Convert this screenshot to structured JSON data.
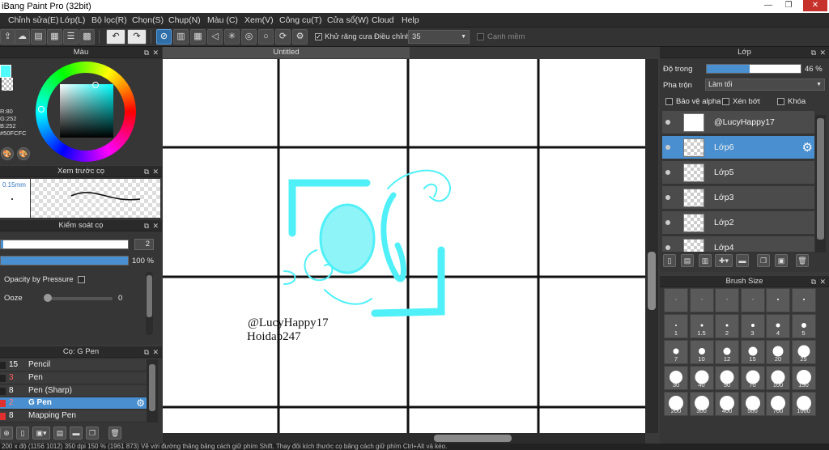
{
  "window": {
    "title": "iBang Paint Pro (32bit)"
  },
  "menu": [
    "Chỉnh sửa(E)",
    "Lớp(L)",
    "Bộ lọc(R)",
    "Chọn(S)",
    "Chụp(N)",
    "Màu (C)",
    "Xem(V)",
    "Công cụ(T)",
    "Cửa sổ(W)",
    "Cloud",
    "Help"
  ],
  "toolbar": {
    "antialias_label": "Khử răng cưa",
    "adjust_label": "Điều chỉnh",
    "adjust_value": "35",
    "soft_edge_label": "Cạnh mềm"
  },
  "color_panel": {
    "title": "Màu",
    "r": "R:80",
    "g": "G:252",
    "b": "B:252",
    "hex": "#50FCFC",
    "color": "#50FCFC"
  },
  "preview_panel": {
    "title": "Xem trước cọ",
    "size": "0.15mm"
  },
  "control_panel": {
    "title": "Kiểm soát cọ",
    "size_value": "2",
    "size_fraction": 0.02,
    "opacity_value": "100 %",
    "opacity_fraction": 1.0,
    "opacity_pressure_label": "Opacity by Pressure",
    "ooze_label": "Ooze",
    "ooze_value": "0"
  },
  "brush_panel": {
    "title": "Cọ: G Pen",
    "items": [
      {
        "num": "15",
        "name": "Pencil",
        "color": "#222222",
        "num_color": "#ffffff"
      },
      {
        "num": "3",
        "name": "Pen",
        "color": "#222222",
        "num_color": "#ff5a5a"
      },
      {
        "num": "8",
        "name": "Pen (Sharp)",
        "color": "#222222",
        "num_color": "#ffffff"
      },
      {
        "num": "2",
        "name": "G Pen",
        "color": "#e03030",
        "num_color": "#ff8080"
      },
      {
        "num": "8",
        "name": "Mapping Pen",
        "color": "#e03030",
        "num_color": "#ffffff"
      }
    ]
  },
  "canvas": {
    "tab_title": "Untitled",
    "watermark_line1": "@LucyHappy17",
    "watermark_line2": "Hoidap247"
  },
  "layer_panel": {
    "title": "Lớp",
    "opacity_label": "Độ trong",
    "opacity_value": "46 %",
    "opacity_fraction": 0.46,
    "blend_label": "Pha trộn",
    "blend_value": "Làm tối",
    "protect_alpha": "Bảo vệ alpha",
    "clipping": "Xén bớt",
    "lock": "Khóa",
    "layers": [
      {
        "name": "@LucyHappy17",
        "selected": false
      },
      {
        "name": "Lớp6",
        "selected": true
      },
      {
        "name": "Lớp5",
        "selected": false
      },
      {
        "name": "Lớp3",
        "selected": false
      },
      {
        "name": "Lớp2",
        "selected": false
      },
      {
        "name": "Lớp4",
        "selected": false
      }
    ]
  },
  "brush_size_panel": {
    "title": "Brush Size",
    "sizes": [
      "",
      "",
      "",
      "",
      "",
      "",
      "1",
      "1.5",
      "2",
      "3",
      "4",
      "5",
      "7",
      "10",
      "12",
      "15",
      "20",
      "25",
      "30",
      "40",
      "50",
      "70",
      "100",
      "150",
      "200",
      "300",
      "400",
      "500",
      "700",
      "1000"
    ]
  },
  "status": {
    "text": "200 x độ (1156 1012) 350 dpi 150 % (1961 873) Vẽ với đường thẳng bằng cách giữ phím Shift. Thay đổi kích thước cọ bằng cách giữ phím Ctrl+Alt và kéo."
  }
}
